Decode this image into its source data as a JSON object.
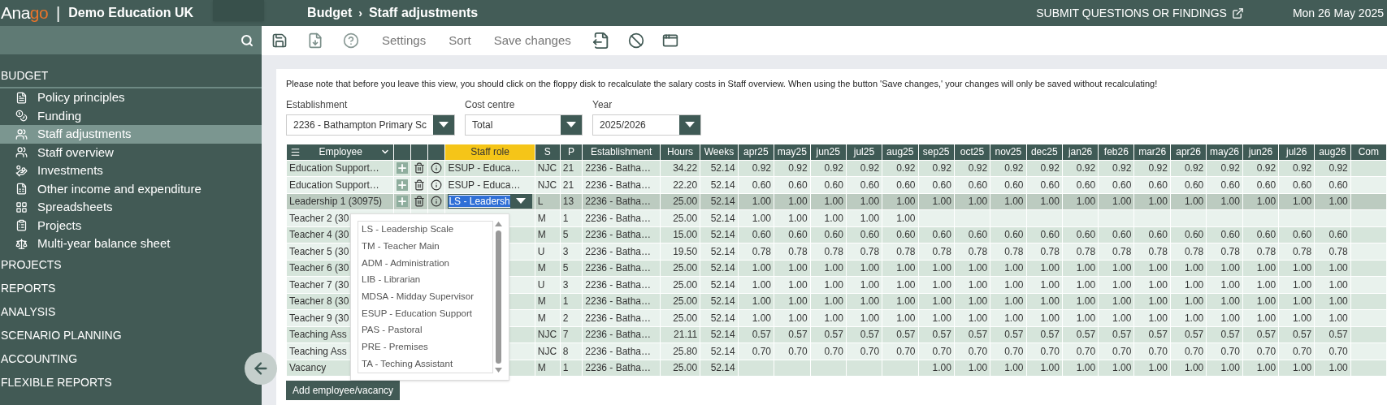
{
  "header": {
    "logo": [
      "Ana",
      "go"
    ],
    "separator": "|",
    "breadcrumb_separator": "›",
    "organisation": "Demo Education UK",
    "breadcrumb": [
      "Budget",
      "Staff adjustments"
    ],
    "submit_link": "SUBMIT QUESTIONS OR FINDINGS",
    "date": "Mon 26 May 2025"
  },
  "sidebar": {
    "sections": [
      {
        "label": "BUDGET",
        "expanded": true,
        "items": [
          {
            "label": "Policy principles",
            "selected": false
          },
          {
            "label": "Funding",
            "selected": false
          },
          {
            "label": "Staff adjustments",
            "selected": true
          },
          {
            "label": "Staff overview",
            "selected": false
          },
          {
            "label": "Investments",
            "selected": false
          },
          {
            "label": "Other income and expenditure",
            "selected": false
          },
          {
            "label": "Spreadsheets",
            "selected": false
          },
          {
            "label": "Projects",
            "selected": false
          },
          {
            "label": "Multi-year balance sheet",
            "selected": false
          }
        ]
      },
      {
        "label": "PROJECTS",
        "expanded": false
      },
      {
        "label": "REPORTS",
        "expanded": false
      },
      {
        "label": "ANALYSIS",
        "expanded": false
      },
      {
        "label": "SCENARIO PLANNING",
        "expanded": false
      },
      {
        "label": "ACCOUNTING",
        "expanded": false
      },
      {
        "label": "FLEXIBLE REPORTS",
        "expanded": false
      }
    ]
  },
  "toolbar": {
    "buttons": [
      "Settings",
      "Sort",
      "Save changes"
    ]
  },
  "notice": "Please note that before you leave this view, you should click on the floppy disk to recalculate the salary costs in Staff overview. When using the button 'Save changes,' your changes will only be saved without recalculating!",
  "filters": [
    {
      "label": "Establishment",
      "value": "2236 - Bathampton Primary Sc"
    },
    {
      "label": "Cost centre",
      "value": "Total"
    },
    {
      "label": "Year",
      "value": "2025/2026"
    }
  ],
  "table": {
    "columns": [
      "Employee",
      "Staff role",
      "S",
      "P",
      "Establishment",
      "Hours",
      "Weeks",
      "apr25",
      "may25",
      "jun25",
      "jul25",
      "aug25",
      "sep25",
      "oct25",
      "nov25",
      "dec25",
      "jan26",
      "feb26",
      "mar26",
      "apr26",
      "may26",
      "jun26",
      "jul26",
      "aug26",
      "Com"
    ],
    "rows": [
      {
        "employee": "Education Support…",
        "actions": true,
        "staff_role": "ESUP - Educa…",
        "editing": false,
        "selected": false,
        "s": "NJC",
        "p": "21",
        "establishment": "2236 - Batha…",
        "hours": "34.22",
        "weeks": "52.14",
        "months": [
          "0.92",
          "0.92",
          "0.92",
          "0.92",
          "0.92",
          "0.92",
          "0.92",
          "0.92",
          "0.92",
          "0.92",
          "0.92",
          "0.92",
          "0.92",
          "0.92",
          "0.92",
          "0.92",
          "0.92"
        ]
      },
      {
        "employee": "Education Support…",
        "actions": true,
        "staff_role": "ESUP - Educa…",
        "editing": false,
        "selected": false,
        "s": "NJC",
        "p": "21",
        "establishment": "2236 - Batha…",
        "hours": "22.20",
        "weeks": "52.14",
        "months": [
          "0.60",
          "0.60",
          "0.60",
          "0.60",
          "0.60",
          "0.60",
          "0.60",
          "0.60",
          "0.60",
          "0.60",
          "0.60",
          "0.60",
          "0.60",
          "0.60",
          "0.60",
          "0.60",
          "0.60"
        ]
      },
      {
        "employee": "Leadership 1 (30975)",
        "actions": true,
        "staff_role": "LS - Leadersh",
        "editing": true,
        "selected": true,
        "s": "L",
        "p": "13",
        "establishment": "2236 - Batha…",
        "hours": "25.00",
        "weeks": "52.14",
        "months": [
          "1.00",
          "1.00",
          "1.00",
          "1.00",
          "1.00",
          "1.00",
          "1.00",
          "1.00",
          "1.00",
          "1.00",
          "1.00",
          "1.00",
          "1.00",
          "1.00",
          "1.00",
          "1.00",
          "1.00"
        ]
      },
      {
        "employee": "Teacher 2 (30",
        "actions": false,
        "selected": false,
        "s": "M",
        "p": "1",
        "establishment": "2236 - Batha…",
        "hours": "25.00",
        "weeks": "52.14",
        "months": [
          "1.00",
          "1.00",
          "1.00",
          "1.00",
          "1.00",
          {
            "blank": true
          },
          {
            "blank": true
          },
          {
            "blank": true
          },
          {
            "blank": true
          },
          {
            "blank": true
          },
          {
            "blank": true
          },
          {
            "blank": true
          },
          {
            "blank": true
          },
          {
            "blank": true
          },
          {
            "blank": true
          },
          {
            "blank": true
          },
          {
            "blank": true
          }
        ]
      },
      {
        "employee": "Teacher 4 (30",
        "actions": false,
        "selected": false,
        "s": "M",
        "p": "5",
        "establishment": "2236 - Batha…",
        "hours": "15.00",
        "weeks": "52.14",
        "months": [
          "0.60",
          "0.60",
          "0.60",
          "0.60",
          "0.60",
          "0.60",
          "0.60",
          "0.60",
          "0.60",
          "0.60",
          "0.60",
          "0.60",
          "0.60",
          "0.60",
          "0.60",
          "0.60",
          "0.60"
        ]
      },
      {
        "employee": "Teacher 5 (30",
        "actions": false,
        "selected": false,
        "s": "U",
        "p": "3",
        "establishment": "2236 - Batha…",
        "hours": "19.50",
        "weeks": "52.14",
        "months": [
          "0.78",
          "0.78",
          "0.78",
          "0.78",
          "0.78",
          "0.78",
          "0.78",
          "0.78",
          "0.78",
          "0.78",
          "0.78",
          "0.78",
          "0.78",
          "0.78",
          "0.78",
          "0.78",
          "0.78"
        ]
      },
      {
        "employee": "Teacher 6 (30",
        "actions": false,
        "selected": false,
        "s": "M",
        "p": "5",
        "establishment": "2236 - Batha…",
        "hours": "25.00",
        "weeks": "52.14",
        "months": [
          "1.00",
          "1.00",
          "1.00",
          "1.00",
          "1.00",
          "1.00",
          "1.00",
          "1.00",
          "1.00",
          "1.00",
          "1.00",
          "1.00",
          "1.00",
          "1.00",
          "1.00",
          "1.00",
          "1.00"
        ]
      },
      {
        "employee": "Teacher 7 (30",
        "actions": false,
        "selected": false,
        "s": "U",
        "p": "3",
        "establishment": "2236 - Batha…",
        "hours": "25.00",
        "weeks": "52.14",
        "months": [
          "1.00",
          "1.00",
          "1.00",
          "1.00",
          "1.00",
          "1.00",
          "1.00",
          "1.00",
          "1.00",
          "1.00",
          "1.00",
          "1.00",
          "1.00",
          "1.00",
          "1.00",
          "1.00",
          "1.00"
        ]
      },
      {
        "employee": "Teacher 8 (30",
        "actions": false,
        "selected": false,
        "s": "M",
        "p": "1",
        "establishment": "2236 - Batha…",
        "hours": "25.00",
        "weeks": "52.14",
        "months": [
          "1.00",
          "1.00",
          "1.00",
          "1.00",
          "1.00",
          "1.00",
          "1.00",
          "1.00",
          "1.00",
          "1.00",
          "1.00",
          "1.00",
          "1.00",
          "1.00",
          "1.00",
          "1.00",
          "1.00"
        ]
      },
      {
        "employee": "Teacher 9 (30",
        "actions": false,
        "selected": false,
        "s": "M",
        "p": "2",
        "establishment": "2236 - Batha…",
        "hours": "25.00",
        "weeks": "52.14",
        "months": [
          "1.00",
          "1.00",
          "1.00",
          "1.00",
          "1.00",
          "1.00",
          "1.00",
          "1.00",
          "1.00",
          "1.00",
          "1.00",
          "1.00",
          "1.00",
          "1.00",
          "1.00",
          "1.00",
          "1.00"
        ]
      },
      {
        "employee": "Teaching Ass",
        "actions": false,
        "selected": false,
        "s": "NJC",
        "p": "7",
        "establishment": "2236 - Batha…",
        "hours": "21.11",
        "weeks": "52.14",
        "months": [
          "0.57",
          "0.57",
          "0.57",
          "0.57",
          "0.57",
          "0.57",
          "0.57",
          "0.57",
          "0.57",
          "0.57",
          "0.57",
          "0.57",
          "0.57",
          "0.57",
          "0.57",
          "0.57",
          "0.57"
        ]
      },
      {
        "employee": "Teaching Ass",
        "actions": false,
        "selected": false,
        "s": "NJC",
        "p": "8",
        "establishment": "2236 - Batha…",
        "hours": "25.80",
        "weeks": "52.14",
        "months": [
          "0.70",
          "0.70",
          "0.70",
          "0.70",
          "0.70",
          "0.70",
          "0.70",
          "0.70",
          "0.70",
          "0.70",
          "0.70",
          "0.70",
          "0.70",
          "0.70",
          "0.70",
          "0.70",
          "0.70"
        ]
      },
      {
        "employee": "Vacancy",
        "actions": false,
        "selected": false,
        "s": "M",
        "p": "1",
        "establishment": "2236 - Batha…",
        "hours": "25.00",
        "weeks": "52.14",
        "months": [
          {
            "blank": true
          },
          {
            "blank": true
          },
          {
            "blank": true
          },
          {
            "blank": true
          },
          {
            "blank": true
          },
          "1.00",
          "1.00",
          "1.00",
          "1.00",
          "1.00",
          "1.00",
          "1.00",
          "1.00",
          "1.00",
          "1.00",
          "1.00",
          "1.00"
        ]
      }
    ]
  },
  "role_dropdown": {
    "open": true,
    "options": [
      "LS - Leadership Scale",
      "TM - Teacher Main",
      "ADM - Administration",
      "LIB - Librarian",
      "MDSA - Midday Supervisor",
      "ESUP - Education Support",
      "PAS - Pastoral",
      "PRE - Premises",
      "TA - Teching Assistant"
    ]
  },
  "add_button": "Add employee/vacancy"
}
